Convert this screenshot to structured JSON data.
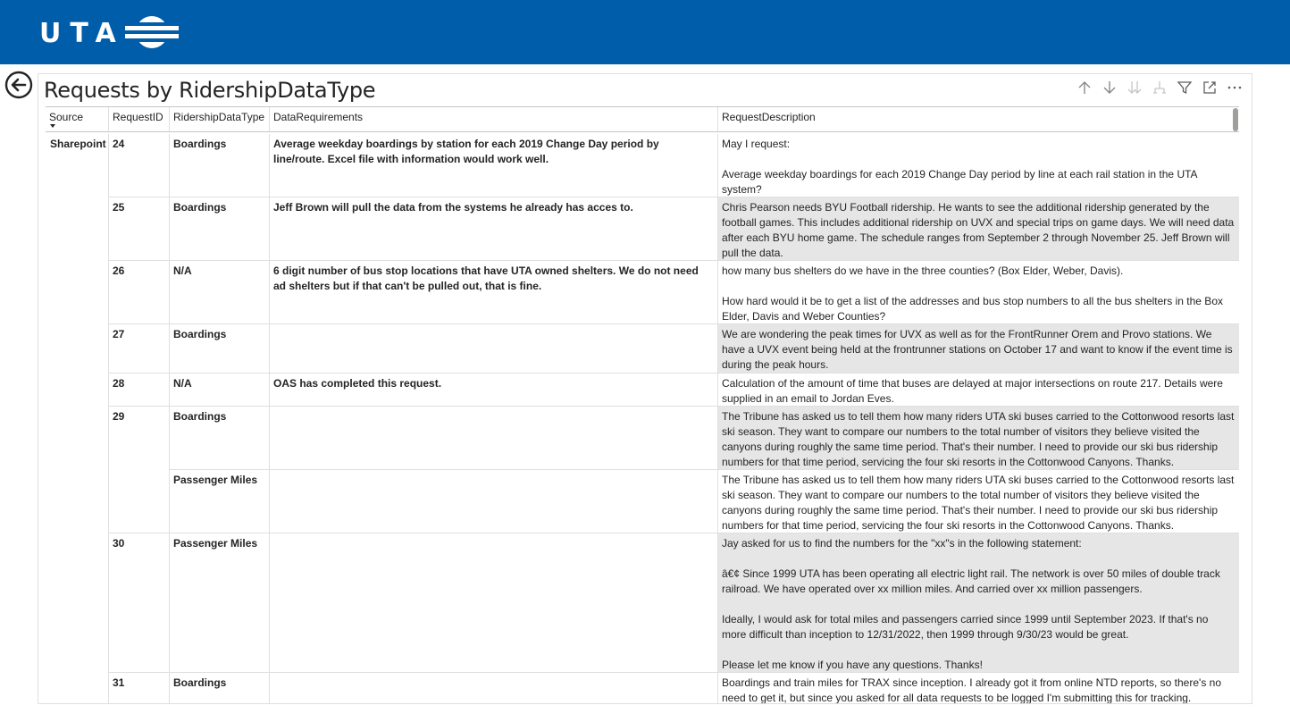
{
  "header": {
    "logo_text": "UTA",
    "logo_icon": "uta-logo-mark"
  },
  "nav": {
    "back_icon": "back-arrow-icon"
  },
  "visual": {
    "title": "Requests by RidershipDataType",
    "toolbar_icons": [
      "sort-up-icon",
      "sort-down-icon",
      "expand-all-icon",
      "expand-hierarchy-icon",
      "filter-icon",
      "focus-mode-icon",
      "more-options-icon"
    ],
    "more_label": "···"
  },
  "table": {
    "columns": [
      "Source",
      "RequestID",
      "RidershipDataType",
      "DataRequirements",
      "RequestDescription"
    ],
    "source_value": "Sharepoint",
    "rows": [
      {
        "id": "24",
        "type": "Boardings",
        "req": "Average weekday boardings by station for each 2019 Change Day period by line/route. Excel file with information would work well.",
        "desc": "May I request:\n\nAverage weekday boardings for each 2019 Change Day period by line at each rail station in the UTA system?",
        "shade": false
      },
      {
        "id": "25",
        "type": "Boardings",
        "req": "Jeff Brown will pull the data from the systems he already has acces to.",
        "desc": "Chris Pearson needs BYU Football ridership. He wants to see the additional ridership generated by the football games. This includes additional ridership on UVX and special trips on game days. We will need data after each BYU home game. The schedule ranges from September 2 through November 25. Jeff Brown will pull the data.",
        "shade": true
      },
      {
        "id": "26",
        "type": "N/A",
        "req": "6 digit number of bus stop locations that have UTA owned shelters. We do not need ad shelters but if that can't be pulled out, that is fine.",
        "desc": "how many bus shelters do we have in the three counties? (Box Elder, Weber, Davis).\n\nHow hard would it be to get a list of the addresses and bus stop numbers to all the bus shelters in the Box Elder, Davis and Weber Counties?",
        "shade": false
      },
      {
        "id": "27",
        "type": "Boardings",
        "req": "",
        "desc": "We are wondering the peak times for UVX as well as for the FrontRunner Orem and Provo stations. We have a UVX event being held at the frontrunner stations on October 17 and want to know if the event time is during the peak hours.",
        "shade": true
      },
      {
        "id": "28",
        "type": "N/A",
        "req": "OAS has completed this request.",
        "desc": "Calculation of the amount of time that buses are delayed at major intersections on route 217. Details were supplied in an email to Jordan Eves.",
        "shade": false
      },
      {
        "id": "29",
        "type": "Boardings",
        "req": "",
        "desc": "The Tribune has asked us to tell them how many riders UTA ski buses carried to the Cottonwood resorts last ski season. They want to compare our numbers to the total number of visitors they believe visited the canyons during roughly the same time period. That's their number. I need to provide our ski bus ridership numbers for that time period, servicing the four ski resorts in the Cottonwood Canyons. Thanks.",
        "shade": true
      },
      {
        "id": "",
        "type": "Passenger Miles",
        "req": "",
        "desc": "The Tribune has asked us to tell them how many riders UTA ski buses carried to the Cottonwood resorts last ski season. They want to compare our numbers to the total number of visitors they believe visited the canyons during roughly the same time period. That's their number. I need to provide our ski bus ridership numbers for that time period, servicing the four ski resorts in the Cottonwood Canyons. Thanks.",
        "shade": false
      },
      {
        "id": "30",
        "type": "Passenger Miles",
        "req": "",
        "desc": "Jay asked for us to find the numbers for the \"xx\"s in the following statement:\n\nâ€¢ Since 1999 UTA has been operating all electric light rail. The network is over 50 miles of double track railroad. We have operated over xx million miles. And carried over xx million passengers.\n\nIdeally, I would ask for total miles and passengers carried since 1999 until September 2023. If that's no more difficult than inception to 12/31/2022, then 1999 through 9/30/23 would be great.\n\nPlease let me know if you have any questions. Thanks!",
        "shade": true
      },
      {
        "id": "31",
        "type": "Boardings",
        "req": "",
        "desc": "Boardings and train miles for TRAX since inception. I already got it from online NTD reports, so there's no need to get it, but since you asked for all data requests to be logged I'm submitting this for tracking.",
        "shade": false
      }
    ]
  }
}
